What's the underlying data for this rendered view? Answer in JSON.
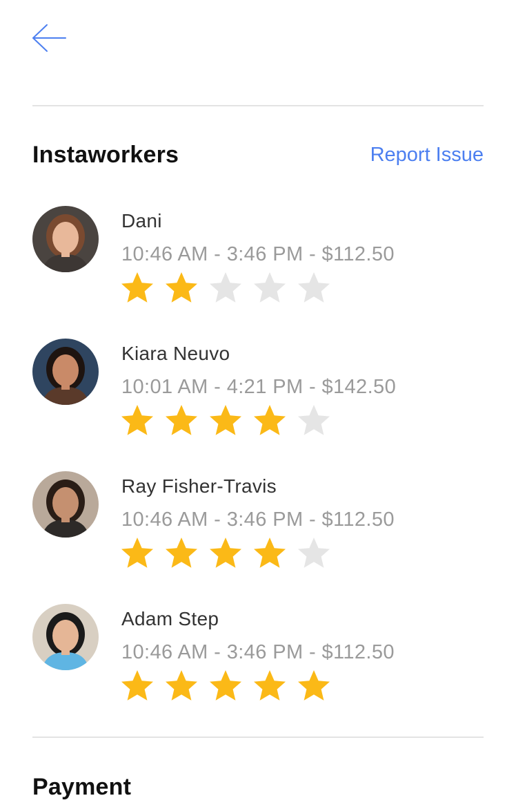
{
  "header": {
    "back_icon": "arrow-left-icon"
  },
  "instaworkers": {
    "title": "Instaworkers",
    "report_label": "Report Issue",
    "workers": [
      {
        "name": "Dani",
        "time": "10:46 AM - 3:46 PM - $112.50",
        "rating": 2,
        "max_rating": 5,
        "avatar_colors": {
          "bg": "#4a4440",
          "hair": "#7a4a30",
          "skin": "#e8b89a",
          "shirt": "#3d3734"
        }
      },
      {
        "name": "Kiara Neuvo",
        "time": "10:01 AM - 4:21 PM - $142.50",
        "rating": 4,
        "max_rating": 5,
        "avatar_colors": {
          "bg": "#2f4560",
          "hair": "#1e1410",
          "skin": "#c98a68",
          "shirt": "#5a3a2a"
        }
      },
      {
        "name": "Ray Fisher-Travis",
        "time": "10:46 AM - 3:46 PM - $112.50",
        "rating": 4,
        "max_rating": 5,
        "avatar_colors": {
          "bg": "#b9a99a",
          "hair": "#2a1d16",
          "skin": "#c59070",
          "shirt": "#2d2a28"
        }
      },
      {
        "name": "Adam Step",
        "time": "10:46 AM - 3:46 PM - $112.50",
        "rating": 5,
        "max_rating": 5,
        "avatar_colors": {
          "bg": "#d8cfc2",
          "hair": "#1a1a1a",
          "skin": "#e5b696",
          "shirt": "#5fb5e3"
        }
      }
    ]
  },
  "payment": {
    "title": "Payment"
  },
  "colors": {
    "accent": "#4c7ff0",
    "star_filled": "#fbb917",
    "star_empty": "#e5e5e5",
    "divider": "#e3e3e3"
  }
}
